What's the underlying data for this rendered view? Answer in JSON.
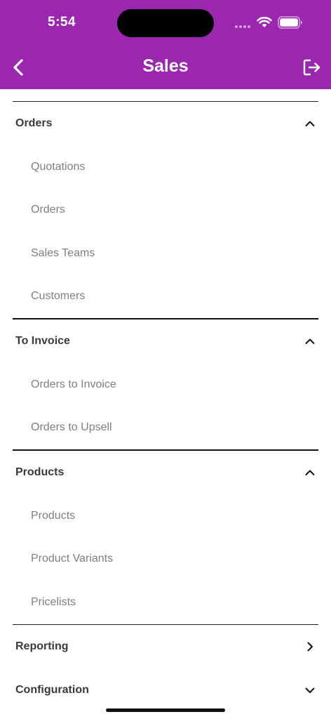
{
  "status_bar": {
    "time": "5:54"
  },
  "header": {
    "title": "Sales",
    "background": "#9b27af",
    "back_icon": "chevron-left-icon",
    "logout_icon": "logout-icon"
  },
  "sections": [
    {
      "label": "Orders",
      "expanded": true,
      "items": [
        "Quotations",
        "Orders",
        "Sales Teams",
        "Customers"
      ]
    },
    {
      "label": "To Invoice",
      "expanded": true,
      "items": [
        "Orders to Invoice",
        "Orders to Upsell"
      ]
    },
    {
      "label": "Products",
      "expanded": true,
      "items": [
        "Products",
        "Product Variants",
        "Pricelists"
      ]
    },
    {
      "label": "Reporting",
      "expanded": false,
      "chevron": "chevron-right-icon",
      "items": []
    },
    {
      "label": "Configuration",
      "expanded": false,
      "chevron": "chevron-down-icon",
      "items": []
    }
  ]
}
